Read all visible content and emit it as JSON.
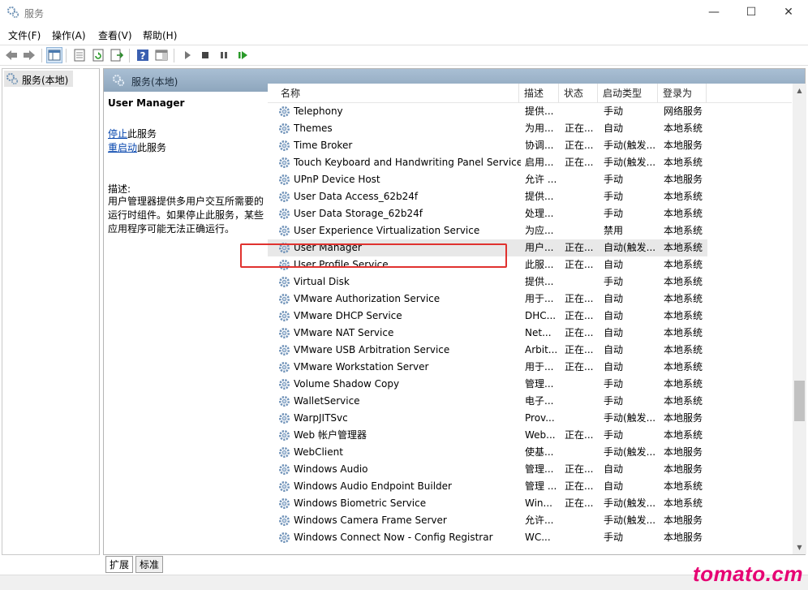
{
  "window": {
    "title": "服务",
    "minimize": "—",
    "maximize": "☐",
    "close": "✕"
  },
  "menu": [
    "文件(F)",
    "操作(A)",
    "查看(V)",
    "帮助(H)"
  ],
  "tree": {
    "selected": "服务(本地)"
  },
  "pane": {
    "header": "服务(本地)"
  },
  "details": {
    "service_name": "User Manager",
    "stop_link": "停止",
    "stop_suffix": "此服务",
    "restart_link": "重启动",
    "restart_suffix": "此服务",
    "desc_label": "描述:",
    "desc_text": "用户管理器提供多用户交互所需要的运行时组件。如果停止此服务，某些应用程序可能无法正确运行。"
  },
  "columns": [
    "名称",
    "描述",
    "状态",
    "启动类型",
    "登录为"
  ],
  "services": [
    {
      "name": "Telephony",
      "desc": "提供...",
      "status": "",
      "startup": "手动",
      "logon": "网络服务"
    },
    {
      "name": "Themes",
      "desc": "为用...",
      "status": "正在...",
      "startup": "自动",
      "logon": "本地系统"
    },
    {
      "name": "Time Broker",
      "desc": "协调...",
      "status": "正在...",
      "startup": "手动(触发...",
      "logon": "本地服务"
    },
    {
      "name": "Touch Keyboard and Handwriting Panel Service",
      "desc": "启用...",
      "status": "正在...",
      "startup": "手动(触发...",
      "logon": "本地系统"
    },
    {
      "name": "UPnP Device Host",
      "desc": "允许 ...",
      "status": "",
      "startup": "手动",
      "logon": "本地服务"
    },
    {
      "name": "User Data Access_62b24f",
      "desc": "提供...",
      "status": "",
      "startup": "手动",
      "logon": "本地系统"
    },
    {
      "name": "User Data Storage_62b24f",
      "desc": "处理...",
      "status": "",
      "startup": "手动",
      "logon": "本地系统"
    },
    {
      "name": "User Experience Virtualization Service",
      "desc": "为应...",
      "status": "",
      "startup": "禁用",
      "logon": "本地系统"
    },
    {
      "name": "User Manager",
      "desc": "用户...",
      "status": "正在...",
      "startup": "自动(触发...",
      "logon": "本地系统",
      "selected": true
    },
    {
      "name": "User Profile Service",
      "desc": "此服...",
      "status": "正在...",
      "startup": "自动",
      "logon": "本地系统"
    },
    {
      "name": "Virtual Disk",
      "desc": "提供...",
      "status": "",
      "startup": "手动",
      "logon": "本地系统"
    },
    {
      "name": "VMware Authorization Service",
      "desc": "用于...",
      "status": "正在...",
      "startup": "自动",
      "logon": "本地系统"
    },
    {
      "name": "VMware DHCP Service",
      "desc": "DHC...",
      "status": "正在...",
      "startup": "自动",
      "logon": "本地系统"
    },
    {
      "name": "VMware NAT Service",
      "desc": "Net...",
      "status": "正在...",
      "startup": "自动",
      "logon": "本地系统"
    },
    {
      "name": "VMware USB Arbitration Service",
      "desc": "Arbit...",
      "status": "正在...",
      "startup": "自动",
      "logon": "本地系统"
    },
    {
      "name": "VMware Workstation Server",
      "desc": "用于...",
      "status": "正在...",
      "startup": "自动",
      "logon": "本地系统"
    },
    {
      "name": "Volume Shadow Copy",
      "desc": "管理...",
      "status": "",
      "startup": "手动",
      "logon": "本地系统"
    },
    {
      "name": "WalletService",
      "desc": "电子...",
      "status": "",
      "startup": "手动",
      "logon": "本地系统"
    },
    {
      "name": "WarpJITSvc",
      "desc": "Prov...",
      "status": "",
      "startup": "手动(触发...",
      "logon": "本地服务"
    },
    {
      "name": "Web 帐户管理器",
      "desc": "Web...",
      "status": "正在...",
      "startup": "手动",
      "logon": "本地系统"
    },
    {
      "name": "WebClient",
      "desc": "使基...",
      "status": "",
      "startup": "手动(触发...",
      "logon": "本地服务"
    },
    {
      "name": "Windows Audio",
      "desc": "管理...",
      "status": "正在...",
      "startup": "自动",
      "logon": "本地服务"
    },
    {
      "name": "Windows Audio Endpoint Builder",
      "desc": "管理 ...",
      "status": "正在...",
      "startup": "自动",
      "logon": "本地系统"
    },
    {
      "name": "Windows Biometric Service",
      "desc": "Win...",
      "status": "正在...",
      "startup": "手动(触发...",
      "logon": "本地系统"
    },
    {
      "name": "Windows Camera Frame Server",
      "desc": "允许...",
      "status": "",
      "startup": "手动(触发...",
      "logon": "本地服务"
    },
    {
      "name": "Windows Connect Now - Config Registrar",
      "desc": "WC...",
      "status": "",
      "startup": "手动",
      "logon": "本地服务"
    }
  ],
  "tabs": [
    "扩展",
    "标准"
  ],
  "watermark": "tomato.cm",
  "colors": {
    "highlight_box": "#e0322f",
    "watermark": "#e60073",
    "header_bg": "#9cb3c9"
  },
  "icons": {
    "service": "gear-icon"
  }
}
